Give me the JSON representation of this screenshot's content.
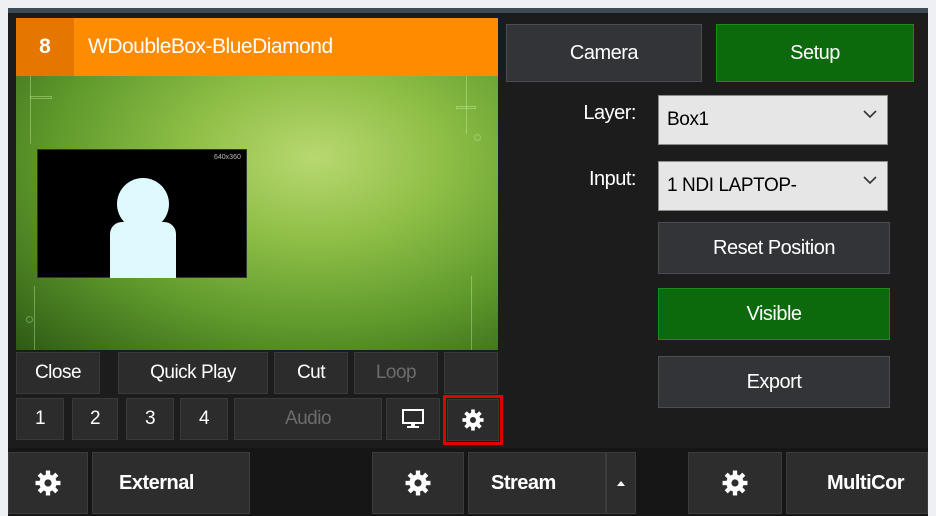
{
  "input_tile": {
    "number": "8",
    "title": "WDoubleBox-BlueDiamond",
    "resolution_label": "640x360",
    "buttons": {
      "close": "Close",
      "quick_play": "Quick Play",
      "cut": "Cut",
      "loop": "Loop",
      "overlay_1": "1",
      "overlay_2": "2",
      "overlay_3": "3",
      "overlay_4": "4",
      "audio": "Audio"
    },
    "icons": {
      "monitor": "monitor-icon",
      "settings": "gear-icon"
    }
  },
  "right_panel": {
    "tabs": {
      "camera": "Camera",
      "setup": "Setup"
    },
    "layer_label": "Layer:",
    "layer_value": "Box1",
    "input_label": "Input:",
    "input_value": "1 NDI LAPTOP-",
    "reset_position": "Reset Position",
    "visible": "Visible",
    "export": "Export"
  },
  "bottom_bar": {
    "external": "External",
    "stream": "Stream",
    "multicorder": "MultiCor"
  },
  "colors": {
    "title_bar": "#ff8c00",
    "active_green": "#0c6a0c",
    "highlight_box": "#e00000",
    "panel_bg": "#1c1c1c"
  }
}
